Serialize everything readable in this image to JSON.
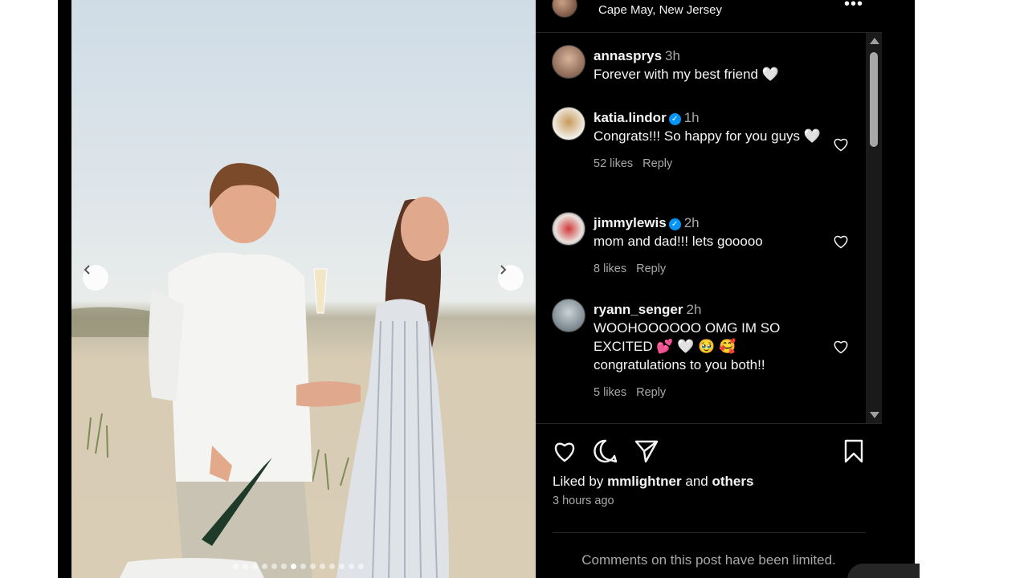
{
  "post": {
    "location": "Cape May, New Jersey",
    "carousel": {
      "total": 14,
      "active_index": 6
    }
  },
  "comments": [
    {
      "username": "annasprys",
      "verified": false,
      "time": "3h",
      "text": "Forever with my best friend 🤍",
      "likes": "",
      "reply": ""
    },
    {
      "username": "katia.lindor",
      "verified": true,
      "time": "1h",
      "text": "Congrats!!! So happy for you guys 🤍",
      "likes": "52 likes",
      "reply": "Reply"
    },
    {
      "username": "jimmylewis",
      "verified": true,
      "time": "2h",
      "text": "mom and dad!!! lets gooooo",
      "likes": "8 likes",
      "reply": "Reply"
    },
    {
      "username": "ryann_senger",
      "verified": false,
      "time": "2h",
      "text": "WOOHOOOOOO OMG IM SO EXCITED 💕 🤍 🥹 🥰 congratulations to you both!!",
      "likes": "5 likes",
      "reply": "Reply"
    }
  ],
  "footer": {
    "liked_prefix": "Liked by",
    "liked_user": "mmlightner",
    "liked_and": "and",
    "liked_others": "others",
    "timestamp": "3 hours ago",
    "comments_limited": "Comments on this post have been limited."
  },
  "icons": {
    "prev": "chevron-left-icon",
    "next": "chevron-right-icon",
    "like": "heart-icon",
    "comment": "comment-icon",
    "share": "send-icon",
    "save": "bookmark-icon"
  },
  "colors": {
    "background": "#000000",
    "text": "#f5f5f5",
    "muted": "#a8a8a8",
    "verified": "#0095f6"
  }
}
